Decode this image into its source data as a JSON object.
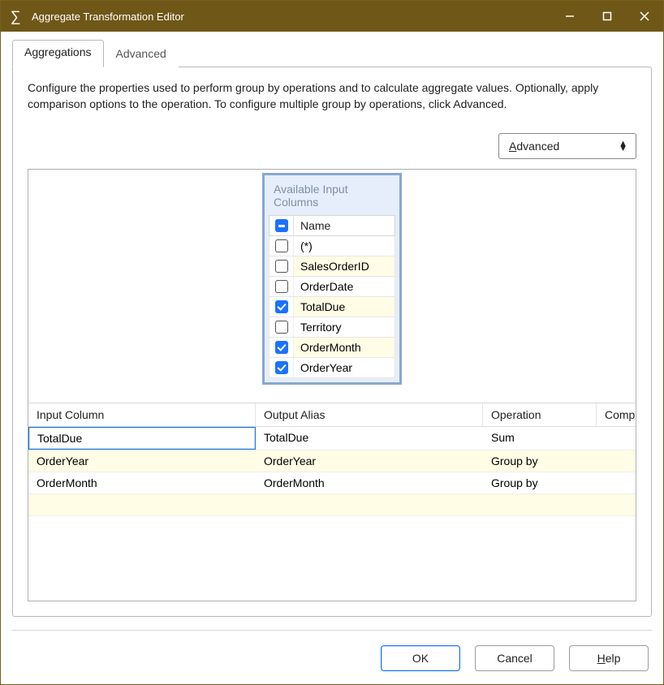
{
  "window": {
    "title": "Aggregate Transformation Editor"
  },
  "tabs": {
    "aggregations": "Aggregations",
    "advanced": "Advanced"
  },
  "description": "Configure the properties used to perform group by operations and to calculate aggregate values. Optionally, apply comparison options to the operation. To configure multiple group by operations, click Advanced.",
  "advanced_dropdown": {
    "underlined_char": "A",
    "rest": "dvanced"
  },
  "available_columns": {
    "title": "Available Input Columns",
    "header": "Name",
    "items": [
      {
        "name": "(*)",
        "checked": false,
        "highlight": false
      },
      {
        "name": "SalesOrderID",
        "checked": false,
        "highlight": true
      },
      {
        "name": "OrderDate",
        "checked": false,
        "highlight": false
      },
      {
        "name": "TotalDue",
        "checked": true,
        "highlight": true
      },
      {
        "name": "Territory",
        "checked": false,
        "highlight": false
      },
      {
        "name": "OrderMonth",
        "checked": true,
        "highlight": true
      },
      {
        "name": "OrderYear",
        "checked": true,
        "highlight": false
      }
    ]
  },
  "grid": {
    "headers": {
      "c1": "Input Column",
      "c2": "Output Alias",
      "c3": "Operation",
      "c4": "Compa"
    },
    "rows": [
      {
        "input": "TotalDue",
        "alias": "TotalDue",
        "op": "Sum",
        "alt": false,
        "selected": true
      },
      {
        "input": "OrderYear",
        "alias": "OrderYear",
        "op": "Group by",
        "alt": true,
        "selected": false
      },
      {
        "input": "OrderMonth",
        "alias": "OrderMonth",
        "op": "Group by",
        "alt": false,
        "selected": false
      }
    ]
  },
  "buttons": {
    "ok": "OK",
    "cancel": "Cancel",
    "help_u": "H",
    "help_rest": "elp"
  }
}
